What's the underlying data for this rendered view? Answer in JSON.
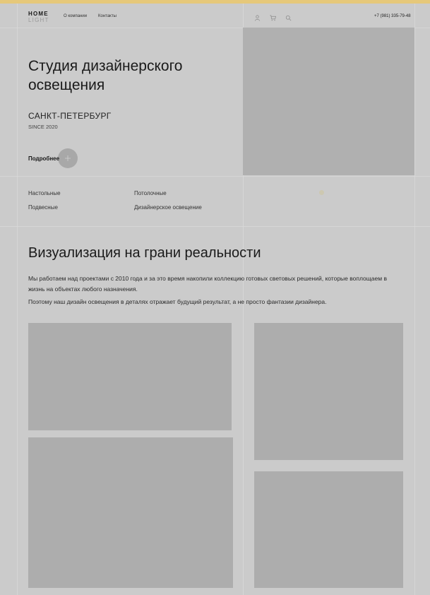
{
  "header": {
    "logo": {
      "line1": "HOME",
      "line2": "LIGHT"
    },
    "nav": [
      "О компании",
      "Контакты"
    ],
    "icons": [
      "user-icon",
      "cart-icon",
      "search-icon"
    ],
    "phone": "+7 (981) 335-79-48"
  },
  "hero": {
    "title": "Студия дизайнерского освещения",
    "city": "САНКТ-ПЕТЕРБУРГ",
    "since": "SINCE 2020",
    "more_label": "Подробнее"
  },
  "categories": [
    "Настольные",
    "Потолочные",
    "Подвесные",
    "Дизайнерское освещение"
  ],
  "section": {
    "title": "Визуализация на грани реальности",
    "paragraph1": "Мы работаем над проектами с 2010 года и за это время накопили коллекцию готовых световых решений, которые воплощаем в жизнь на объектах любого назначения.",
    "paragraph2": "Поэтому наш дизайн освещения в деталях отражает будущий результат, а не просто фантазии дизайнера."
  },
  "colors": {
    "background": "#cbcbcb",
    "placeholder": "#adadad",
    "accent_bar": "#e6c87a"
  }
}
